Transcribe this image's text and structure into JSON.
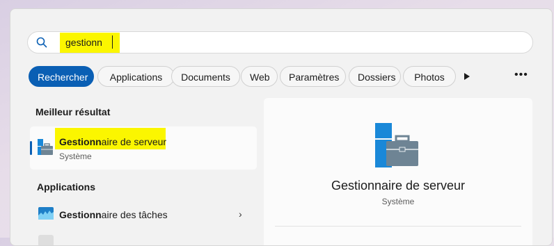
{
  "search": {
    "value": "gestionn"
  },
  "filters": [
    {
      "label": "Rechercher",
      "active": true
    },
    {
      "label": "Applications"
    },
    {
      "label": "Documents"
    },
    {
      "label": "Web"
    },
    {
      "label": "Paramètres"
    },
    {
      "label": "Dossiers"
    },
    {
      "label": "Photos"
    }
  ],
  "more_label": "•••",
  "best": {
    "section_title": "Meilleur résultat",
    "name_match": "Gestionn",
    "name_rest": "aire de serveur",
    "subtitle": "Système"
  },
  "apps": {
    "section_title": "Applications",
    "items": [
      {
        "name_match": "Gestionn",
        "name_rest": "aire des tâches"
      }
    ]
  },
  "preview": {
    "title": "Gestionnaire de serveur",
    "subtitle": "Système"
  },
  "colors": {
    "accent": "#0a5fb4",
    "highlight": "#fbf600",
    "icon_blue": "#1a88d8",
    "icon_gray": "#6e8494"
  }
}
